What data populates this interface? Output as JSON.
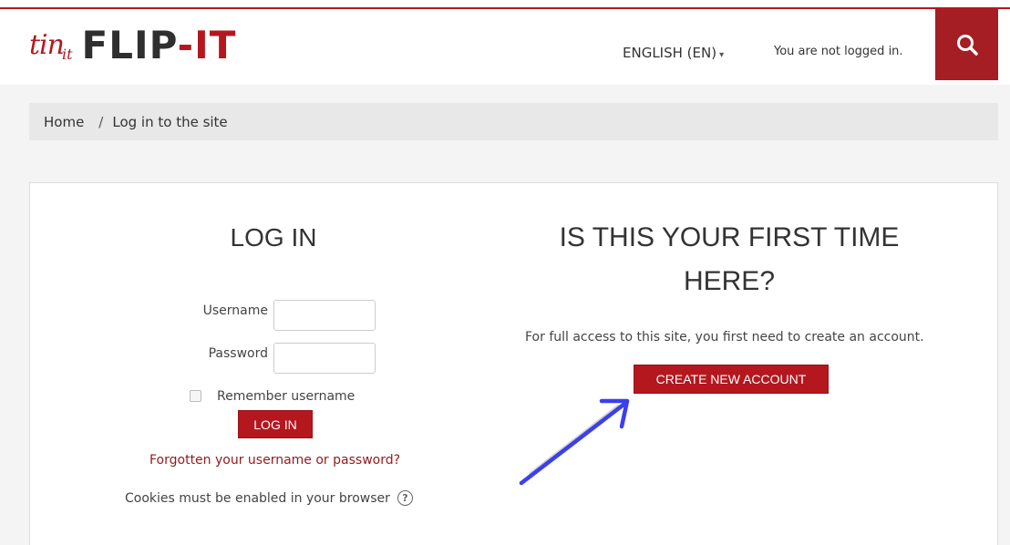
{
  "header": {
    "logo": {
      "mark": "tin",
      "sub": "it",
      "text_main": "FLIP",
      "text_dash": "-",
      "text_it": "IT"
    },
    "language": "ENGLISH (EN)",
    "login_status": "You are not logged in."
  },
  "breadcrumb": {
    "home": "Home",
    "separator": "/",
    "current": "Log in to the site"
  },
  "login": {
    "heading": "LOG IN",
    "username_label": "Username",
    "username_value": "",
    "password_label": "Password",
    "password_value": "",
    "remember_label": "Remember username",
    "remember_checked": false,
    "submit_label": "LOG IN",
    "forgot_link": "Forgotten your username or password?",
    "cookies_text": "Cookies must be enabled in your browser"
  },
  "signup": {
    "heading": "IS THIS YOUR FIRST TIME HERE?",
    "text": "For full access to this site, you first need to create an account.",
    "button_label": "CREATE NEW ACCOUNT"
  },
  "colors": {
    "brand_red": "#b5171f",
    "arrow_blue": "#3b3ff0"
  }
}
